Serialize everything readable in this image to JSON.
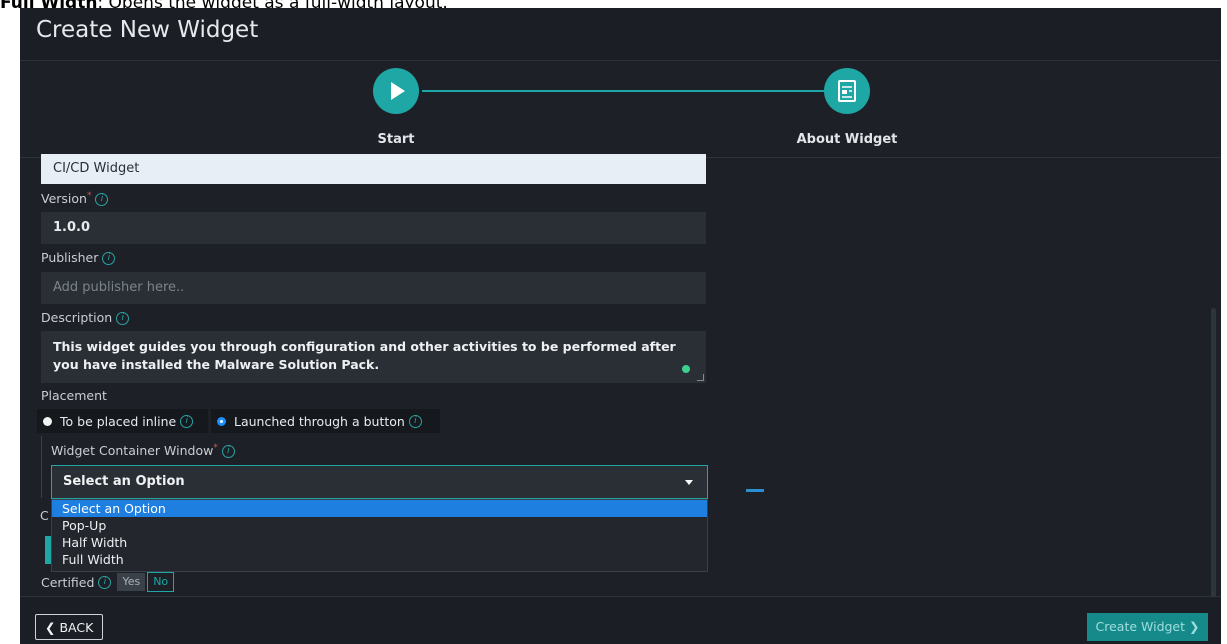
{
  "top_note": {
    "bold": "Full Width",
    "text": ": Opens the widget as a full-width layout."
  },
  "modal": {
    "title": "Create New Widget"
  },
  "stepper": {
    "steps": [
      {
        "label": "Start"
      },
      {
        "label": "About Widget"
      }
    ],
    "accent": "#1fa7a6"
  },
  "form": {
    "name_value": "CI/CD Widget",
    "version": {
      "label": "Version",
      "value": "1.0.0"
    },
    "publisher": {
      "label": "Publisher",
      "placeholder": "Add publisher here.."
    },
    "description": {
      "label": "Description",
      "value": "This widget guides you through configuration and other activities to be performed after you have installed the Malware Solution Pack."
    },
    "placement": {
      "label": "Placement",
      "options": [
        {
          "label": "To be placed inline",
          "selected": false
        },
        {
          "label": "Launched through a button",
          "selected": true
        }
      ]
    },
    "container": {
      "label": "Widget Container Window",
      "selected": "Select an Option",
      "options": [
        "Select an Option",
        "Pop-Up",
        "Half Width",
        "Full Width"
      ]
    },
    "partial_label_letter": "C",
    "certified": {
      "label": "Certified",
      "yes": "Yes",
      "no": "No",
      "value": "No"
    }
  },
  "footer": {
    "back_label": "BACK",
    "create_label": "Create Widget"
  }
}
